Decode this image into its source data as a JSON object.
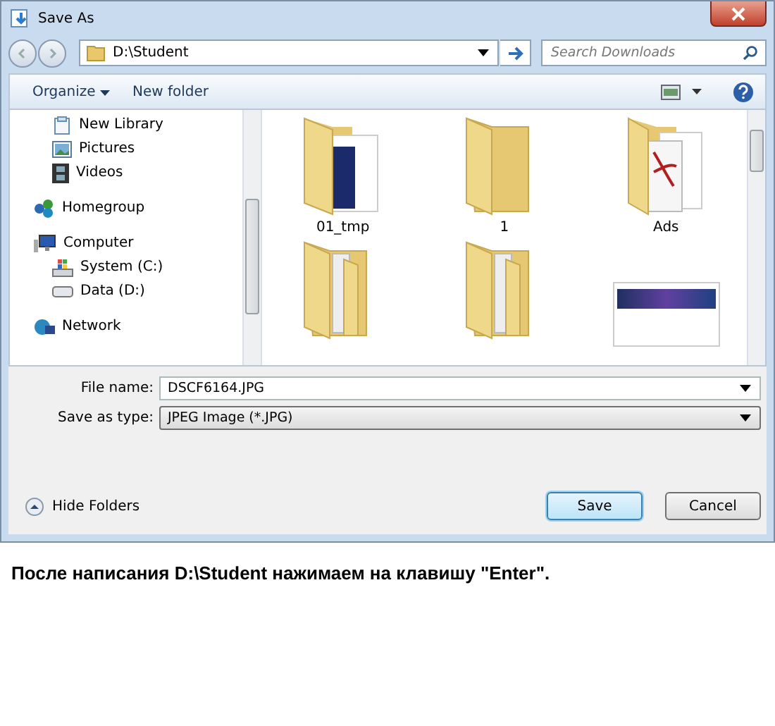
{
  "window": {
    "title": "Save As"
  },
  "address": {
    "value": "D:\\Student"
  },
  "search": {
    "placeholder": "Search Downloads"
  },
  "toolbar": {
    "organize": "Organize",
    "new_folder": "New folder"
  },
  "nav": [
    {
      "label": "New Library",
      "kind": "library"
    },
    {
      "label": "Pictures",
      "kind": "pictures"
    },
    {
      "label": "Videos",
      "kind": "videos"
    },
    {
      "label": "Homegroup",
      "kind": "homegroup"
    },
    {
      "label": "Computer",
      "kind": "computer",
      "children": [
        {
          "label": "System (C:)",
          "kind": "system-drive"
        },
        {
          "label": "Data (D:)",
          "kind": "drive"
        }
      ]
    },
    {
      "label": "Network",
      "kind": "network"
    }
  ],
  "files": [
    {
      "label": "01_tmp",
      "kind": "folder-docs"
    },
    {
      "label": "1",
      "kind": "folder-empty"
    },
    {
      "label": "Ads",
      "kind": "folder-pdf"
    },
    {
      "kind": "folder-papers"
    },
    {
      "kind": "folder-papers"
    },
    {
      "kind": "thumbnail"
    }
  ],
  "form": {
    "file_name_label": "File name:",
    "file_name": "DSCF6164.JPG",
    "type_label": "Save as type:",
    "type": "JPEG Image (*.JPG)"
  },
  "footer": {
    "hide_folders": "Hide Folders",
    "save": "Save",
    "cancel": "Cancel"
  },
  "caption": "После написания D:\\Student нажимаем на клавишу \"Enter\"."
}
